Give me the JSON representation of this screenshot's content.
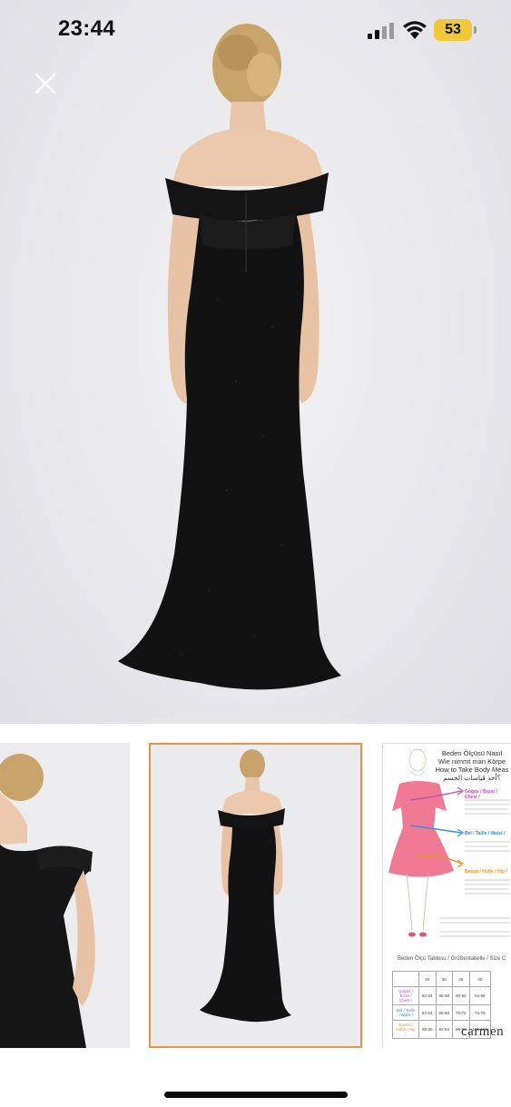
{
  "status_bar": {
    "time": "23:44",
    "battery_level": "53",
    "battery_color": "#f0c93a"
  },
  "viewer": {
    "close_icon": "close-icon"
  },
  "thumbnails": [
    {
      "name": "front-view"
    },
    {
      "name": "back-view",
      "selected": true,
      "border_color": "#e0954a"
    },
    {
      "name": "size-chart"
    }
  ],
  "size_chart": {
    "title_lines": [
      "Beden Ölçüsü Nasıl",
      "Wie nimmt man Körpe",
      "How to Take Body Meas",
      "؟أخذ قياسات الجسم"
    ],
    "chest_label": "Göğüs / Brust / Chest /",
    "waist_label": "Bel / Taille / Waist /",
    "hip_label": "Basen / Hüfte / Hip /",
    "table_title": "Beden Ölçü Tablosu / Größentabelle / Size C",
    "sizes": [
      "34",
      "36",
      "38",
      "40"
    ],
    "rows": [
      {
        "label": "Göğüs / Brust / Chest /",
        "values": [
          "82-84",
          "86-88",
          "90-92",
          "94-96"
        ]
      },
      {
        "label": "Bel / Taille / Waist /",
        "values": [
          "62-64",
          "66-68",
          "70-72",
          "74-76"
        ]
      },
      {
        "label": "Basen / Hüfte / Hip /",
        "values": [
          "88-90",
          "92-94",
          "96-98",
          "100-102"
        ]
      }
    ],
    "brand": "carmen"
  }
}
